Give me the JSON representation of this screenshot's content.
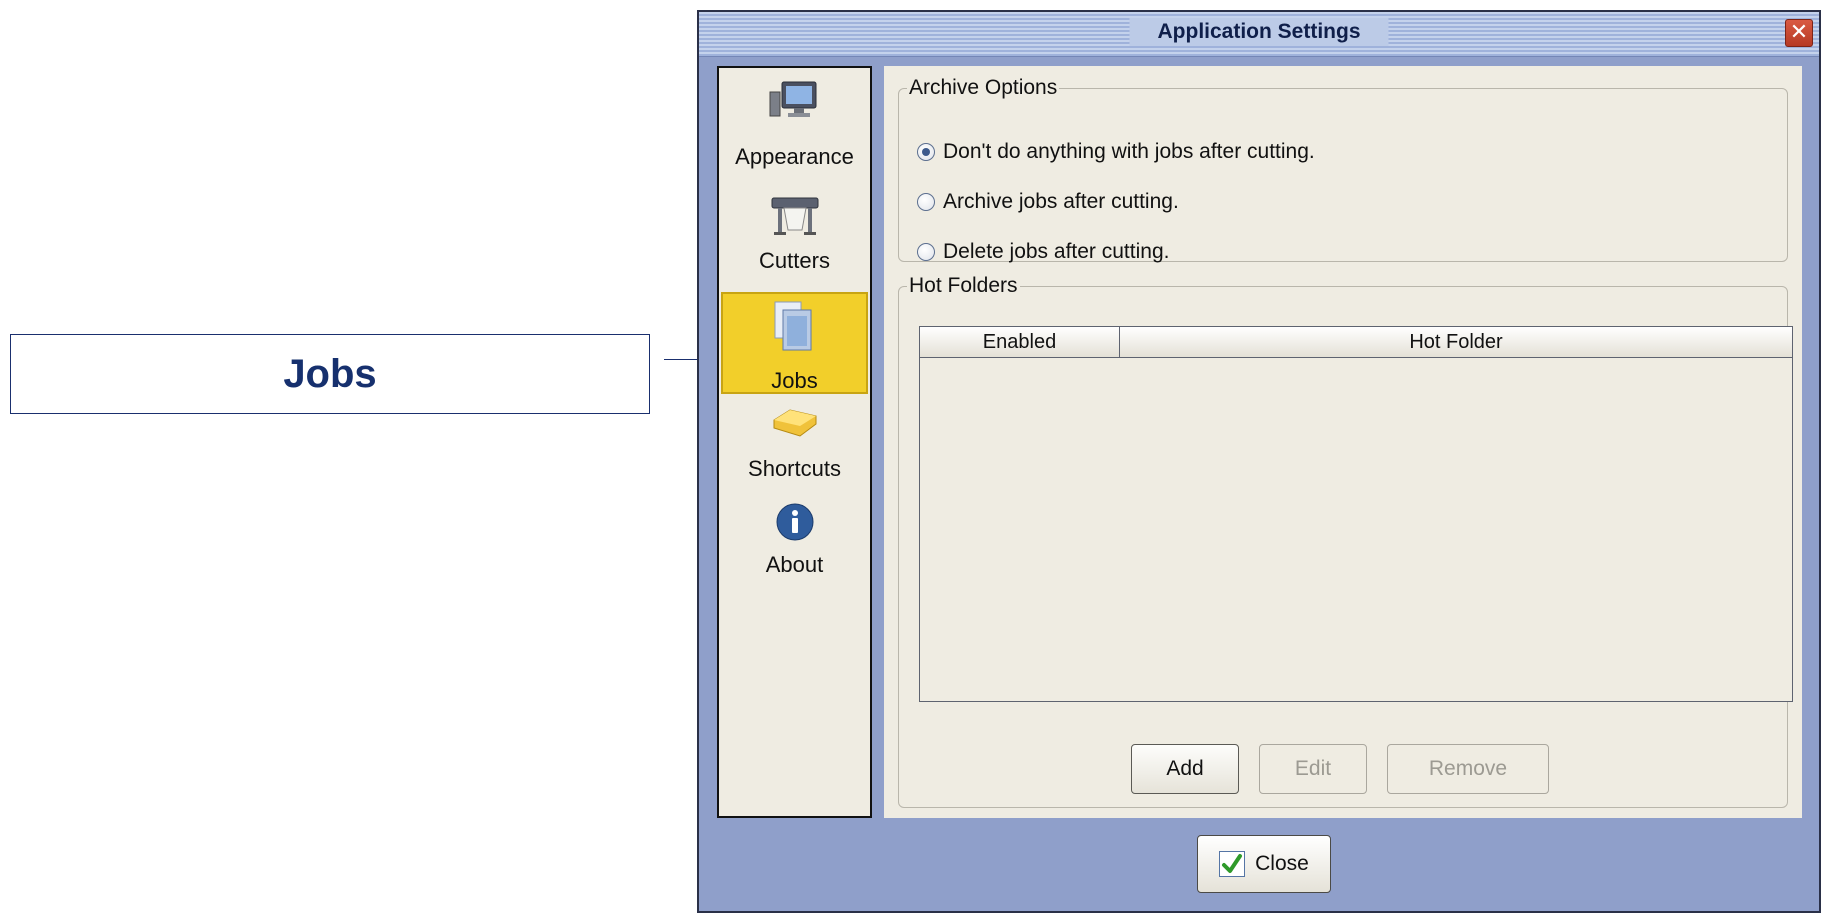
{
  "callout": {
    "label": "Jobs"
  },
  "window": {
    "title": "Application Settings",
    "close_glyph": "✕"
  },
  "sidebar": {
    "items": [
      {
        "label": "Appearance",
        "icon": "monitor-icon"
      },
      {
        "label": "Cutters",
        "icon": "plotter-icon"
      },
      {
        "label": "Jobs",
        "icon": "documents-icon",
        "selected": true
      },
      {
        "label": "Shortcuts",
        "icon": "key-icon"
      },
      {
        "label": "About",
        "icon": "info-icon"
      }
    ]
  },
  "archive": {
    "legend": "Archive Options",
    "options": [
      {
        "label": "Don't do anything with jobs after cutting.",
        "checked": true
      },
      {
        "label": "Archive jobs after cutting.",
        "checked": false
      },
      {
        "label": "Delete jobs after cutting.",
        "checked": false
      }
    ]
  },
  "hot_folders": {
    "legend": "Hot Folders",
    "columns": [
      "Enabled",
      "Hot Folder"
    ],
    "rows": [],
    "add_label": "Add",
    "edit_label": "Edit",
    "remove_label": "Remove"
  },
  "footer": {
    "close_label": "Close"
  },
  "colors": {
    "selected_bg": "#f2cf2a",
    "window_bg": "#8f9fca",
    "panel_bg": "#efece2",
    "callout_text": "#16306e"
  }
}
